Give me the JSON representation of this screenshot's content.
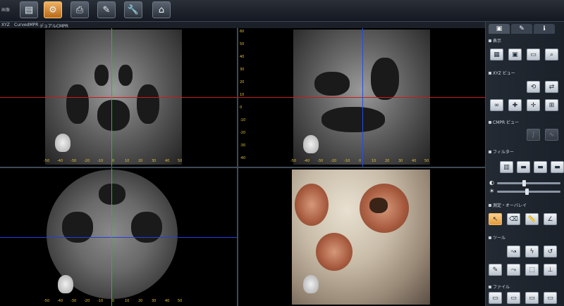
{
  "toolbar": {
    "label": "画像",
    "buttons": [
      {
        "name": "open-volume-button",
        "icon": "layers-icon",
        "glyph": "▤"
      },
      {
        "name": "mpr-button",
        "icon": "mpr-cube-icon",
        "glyph": "⚙",
        "active": true
      },
      {
        "name": "print-button",
        "icon": "printer-icon",
        "glyph": "⎙"
      },
      {
        "name": "report-button",
        "icon": "pencil-note-icon",
        "glyph": "✎"
      },
      {
        "name": "tools-button",
        "icon": "wrench-icon",
        "glyph": "🔧"
      },
      {
        "name": "home-button",
        "icon": "house-icon",
        "glyph": "⌂"
      }
    ]
  },
  "tabs": {
    "xyz": "XYZ",
    "curved": "CurvedMPR",
    "dual": "デュアルCMPR"
  },
  "viewports": {
    "coronal": {
      "h_scale": [
        "-50",
        "-40",
        "-30",
        "-20",
        "-10",
        "0",
        "10",
        "20",
        "30",
        "40",
        "50"
      ],
      "crosshair_h_color": "#d01818",
      "crosshair_v_color": "#20c020"
    },
    "sagittal": {
      "v_scale": [
        "60",
        "50",
        "40",
        "30",
        "20",
        "10",
        "0",
        "-10",
        "-20",
        "-30",
        "-40"
      ],
      "h_scale": [
        "-50",
        "-40",
        "-30",
        "-20",
        "-10",
        "0",
        "10",
        "20",
        "30",
        "40",
        "50"
      ],
      "crosshair_h_color": "#d01818",
      "crosshair_v_color": "#2050e0"
    },
    "axial": {
      "h_scale": [
        "-50",
        "-40",
        "-30",
        "-20",
        "-10",
        "0",
        "10",
        "20",
        "30",
        "40",
        "50"
      ],
      "crosshair_h_color": "#2040e0",
      "crosshair_v_color": "#20c020"
    },
    "volume": {}
  },
  "panel": {
    "tabs": [
      {
        "name": "tab-image",
        "glyph": "▣"
      },
      {
        "name": "tab-notes",
        "glyph": "✎"
      },
      {
        "name": "tab-info",
        "glyph": "ℹ"
      }
    ],
    "sections": {
      "display": "表示",
      "xyz_view": "XYZ ビュー",
      "cmpr_view": "CMPR ビュー",
      "filter": "フィルター",
      "measure": "測定・オーバレイ",
      "tools": "ツール",
      "file": "ファイル"
    }
  }
}
